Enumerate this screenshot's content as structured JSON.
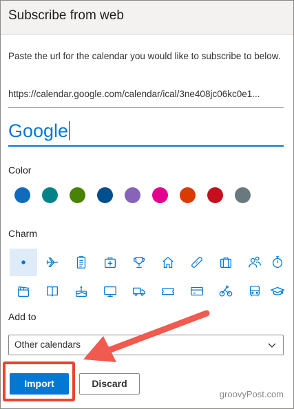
{
  "dialog": {
    "title": "Subscribe from web",
    "instruction": "Paste the url for the calendar you would like to subscribe to below.",
    "url_value": "https://calendar.google.com/calendar/ical/3ne408jc06kc0e1...",
    "name_value": "Google"
  },
  "color": {
    "label": "Color",
    "swatches": [
      "#0f6cbd",
      "#038387",
      "#498205",
      "#004e8c",
      "#8764b8",
      "#e3008c",
      "#da3b01",
      "#c50f1f",
      "#69797e"
    ]
  },
  "charm": {
    "label": "Charm",
    "icons": [
      "dot-icon",
      "airplane-icon",
      "clipboard-icon",
      "first-aid-kit-icon",
      "trophy-icon",
      "home-icon",
      "bandage-icon",
      "briefcase-icon",
      "people-icon",
      "stopwatch-icon",
      "clapperboard-icon",
      "book-icon",
      "cake-icon",
      "monitor-icon",
      "truck-icon",
      "ticket-icon",
      "card-icon",
      "cyclist-icon",
      "bus-icon",
      "graduation-cap-icon"
    ]
  },
  "add_to": {
    "label": "Add to",
    "selected": "Other calendars"
  },
  "buttons": {
    "import": "Import",
    "discard": "Discard"
  },
  "annotation": {
    "highlight_color": "#ea4335",
    "arrow_color": "#f05a4f"
  },
  "watermark": "groovyPost.com"
}
